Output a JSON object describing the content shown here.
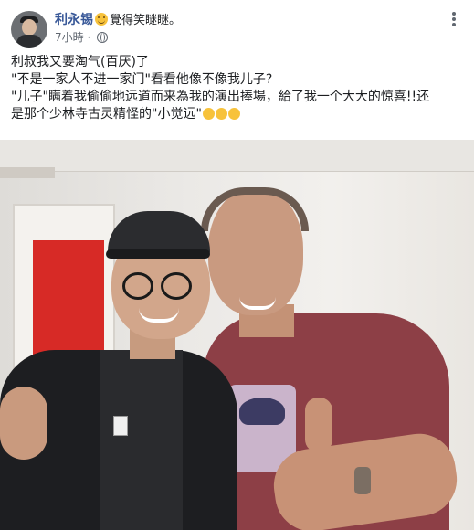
{
  "post": {
    "author": "利永锡",
    "feeling": "覺得笑瞇瞇。",
    "timestamp": "7小時",
    "lines": [
      "利叔我又要淘气(百厌)了",
      "\"不是一家人不进一家门\"看看他像不像我儿子?",
      "\"儿子\"瞒着我偷偷地远道而来為我的演出捧場，給了我一个大大的惊喜!!还",
      "是那个少林寺古灵精怪的\"小觉远\""
    ]
  },
  "icons": {
    "avatar": "profile-photo",
    "feeling_emoji": "smiling-face-icon",
    "privacy": "globe-icon",
    "menu": "more-options-icon",
    "trailing_emojis": [
      "grinning-face-icon",
      "hugging-face-icon",
      "face-blowing-kiss-icon"
    ]
  },
  "colors": {
    "author": "#385898",
    "meta": "#606770",
    "emoji": "#f7c23b"
  }
}
